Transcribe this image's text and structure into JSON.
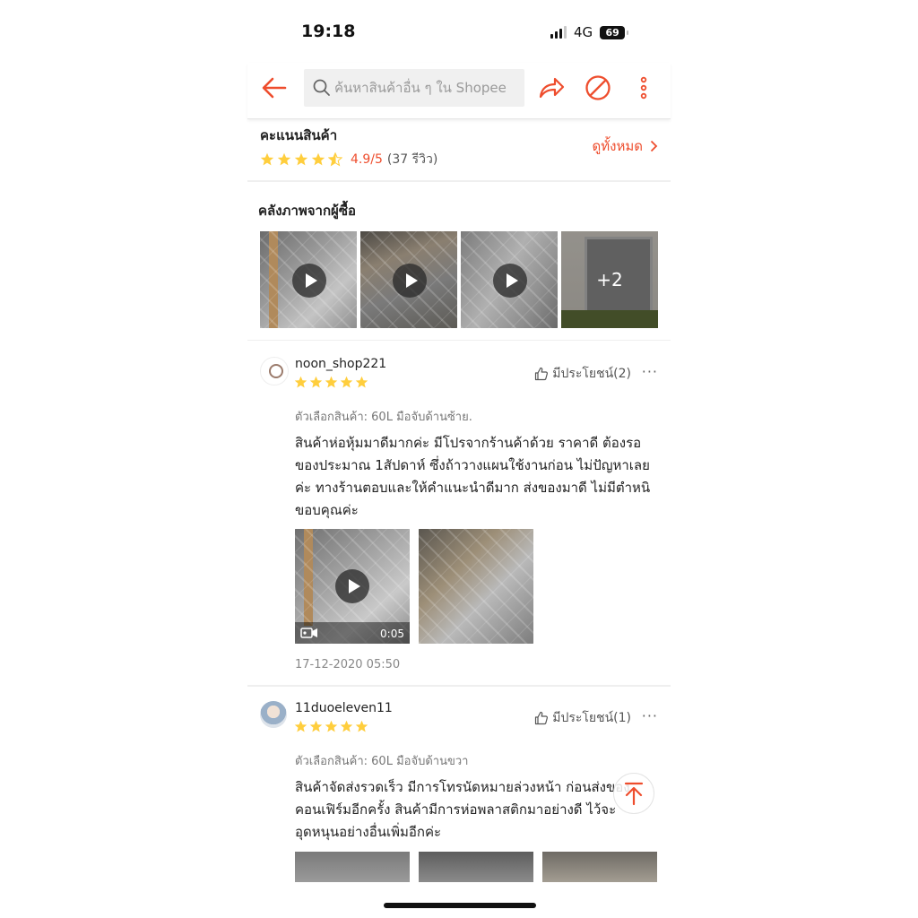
{
  "status_bar": {
    "time": "19:18",
    "network": "4G",
    "battery": "69"
  },
  "header": {
    "search_placeholder": "ค้นหาสินค้าอื่น ๆ ใน Shopee"
  },
  "rating": {
    "title": "คะแนนสินค้า",
    "score": "4.9/5",
    "count": "(37 รีวิว)",
    "see_all": "ดูทั้งหมด",
    "stars": 4.9
  },
  "gallery": {
    "title": "คลังภาพจากผู้ซื้อ",
    "more_label": "+2"
  },
  "reviews": [
    {
      "username": "noon_shop221",
      "stars": 5,
      "helpful": "มีประโยชน์(2)",
      "variant": "ตัวเลือกสินค้า: 60L มือจับด้านซ้าย.",
      "text": "สินค้าห่อหุ้มมาดีมากค่ะ มีโปรจากร้านค้าด้วย ราคาดี ต้องรอของประมาณ 1สัปดาห์ ซึ่งถ้าวางแผนใช้งานก่อน ไม่ปัญหาเลยค่ะ ทางร้านตอบและให้คำแนะนำดีมาก ส่งของมาดี ไม่มีตำหนิ ขอบคุณค่ะ",
      "video_duration": "0:05",
      "date": "17-12-2020 05:50"
    },
    {
      "username": "11duoeleven11",
      "stars": 5,
      "helpful": "มีประโยชน์(1)",
      "variant": "ตัวเลือกสินค้า: 60L มือจับด้านขวา",
      "text": "สินค้าจัดส่งรวดเร็ว มีการโทรนัดหมายล่วงหน้า ก่อนส่งของ คอนเฟิร์มอีกครั้ง สินค้ามีการห่อพลาสติกมาอย่างดี ไว้จะอุดหนุนอย่างอื่นเพิ่มอีกค่ะ"
    }
  ],
  "colors": {
    "accent": "#ee4d2d",
    "star": "#ffce3d"
  }
}
